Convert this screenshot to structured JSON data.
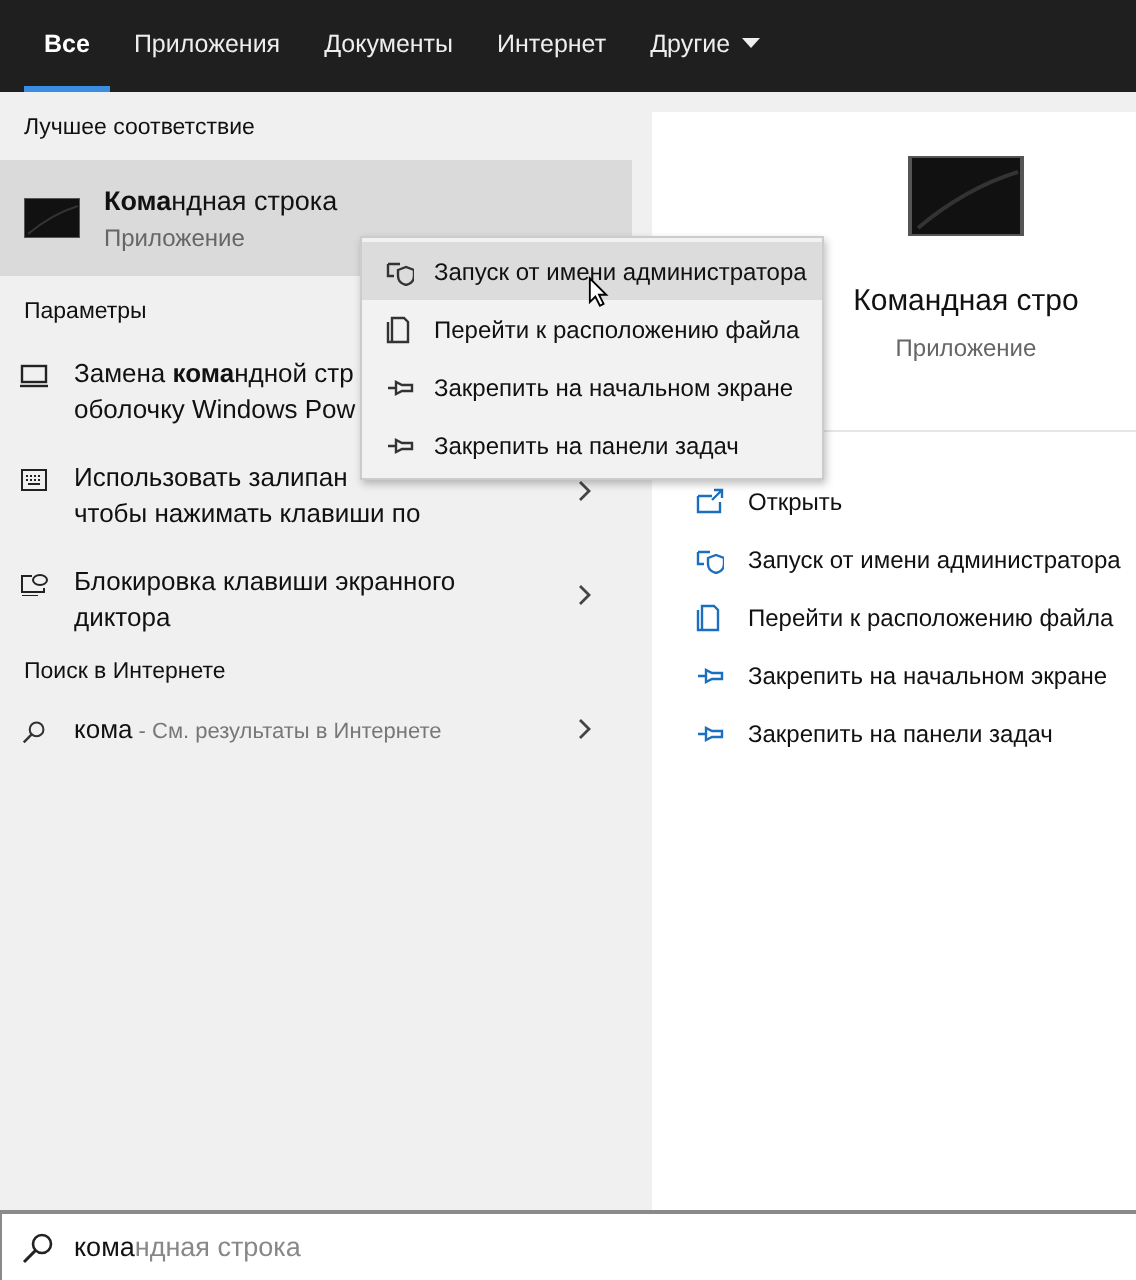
{
  "tabs": [
    {
      "label": "Все",
      "selected": true,
      "dropdown": false
    },
    {
      "label": "Приложения",
      "selected": false,
      "dropdown": false
    },
    {
      "label": "Документы",
      "selected": false,
      "dropdown": false
    },
    {
      "label": "Интернет",
      "selected": false,
      "dropdown": false
    },
    {
      "label": "Другие",
      "selected": false,
      "dropdown": true
    }
  ],
  "best_match": {
    "heading": "Лучшее соответствие",
    "title": "**Кома**ндная строка",
    "subtitle": "Приложение",
    "selected": true
  },
  "settings": {
    "heading": "Параметры",
    "items": [
      {
        "kind": "monitor",
        "lines": [
          "Замена **кома**ндной стр",
          "оболочку Windows Pow"
        ],
        "chevron": false
      },
      {
        "kind": "keyboard",
        "lines": [
          "Использовать залипан",
          "чтобы нажимать клавиши по"
        ],
        "chevron": true
      },
      {
        "kind": "narrator",
        "lines": [
          "Блокировка клавиши экранного",
          "диктора"
        ],
        "chevron": true
      }
    ]
  },
  "web": {
    "heading": "Поиск в Интернете",
    "text": "**кома** - См. результаты в Интернете"
  },
  "context_menu": [
    {
      "kind": "shield",
      "label": "Запуск от имени администратора",
      "selected": true
    },
    {
      "kind": "folder",
      "label": "Перейти к расположению файла",
      "selected": false
    },
    {
      "kind": "pin",
      "label": "Закрепить на начальном экране",
      "selected": false
    },
    {
      "kind": "pin",
      "label": "Закрепить на панели задач",
      "selected": false
    }
  ],
  "preview": {
    "title": "Командная стро",
    "subtitle": "Приложение",
    "actions": [
      {
        "kind": "open",
        "label": "Открыть"
      },
      {
        "kind": "shield",
        "label": "Запуск от имени администратора"
      },
      {
        "kind": "folder",
        "label": "Перейти к расположению файла"
      },
      {
        "kind": "pin",
        "label": "Закрепить на начальном экране"
      },
      {
        "kind": "pin",
        "label": "Закрепить на панели задач"
      }
    ]
  },
  "search": {
    "typed": "кома",
    "suggestion": "ндная строка"
  }
}
